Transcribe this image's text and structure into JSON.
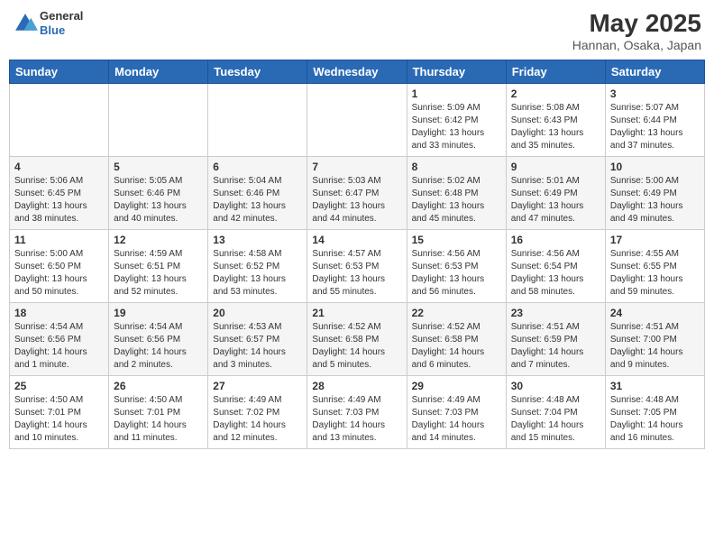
{
  "header": {
    "logo": {
      "line1": "General",
      "line2": "Blue"
    },
    "title": "May 2025",
    "subtitle": "Hannan, Osaka, Japan"
  },
  "weekdays": [
    "Sunday",
    "Monday",
    "Tuesday",
    "Wednesday",
    "Thursday",
    "Friday",
    "Saturday"
  ],
  "weeks": [
    [
      {
        "day": "",
        "info": ""
      },
      {
        "day": "",
        "info": ""
      },
      {
        "day": "",
        "info": ""
      },
      {
        "day": "",
        "info": ""
      },
      {
        "day": "1",
        "info": "Sunrise: 5:09 AM\nSunset: 6:42 PM\nDaylight: 13 hours\nand 33 minutes."
      },
      {
        "day": "2",
        "info": "Sunrise: 5:08 AM\nSunset: 6:43 PM\nDaylight: 13 hours\nand 35 minutes."
      },
      {
        "day": "3",
        "info": "Sunrise: 5:07 AM\nSunset: 6:44 PM\nDaylight: 13 hours\nand 37 minutes."
      }
    ],
    [
      {
        "day": "4",
        "info": "Sunrise: 5:06 AM\nSunset: 6:45 PM\nDaylight: 13 hours\nand 38 minutes."
      },
      {
        "day": "5",
        "info": "Sunrise: 5:05 AM\nSunset: 6:46 PM\nDaylight: 13 hours\nand 40 minutes."
      },
      {
        "day": "6",
        "info": "Sunrise: 5:04 AM\nSunset: 6:46 PM\nDaylight: 13 hours\nand 42 minutes."
      },
      {
        "day": "7",
        "info": "Sunrise: 5:03 AM\nSunset: 6:47 PM\nDaylight: 13 hours\nand 44 minutes."
      },
      {
        "day": "8",
        "info": "Sunrise: 5:02 AM\nSunset: 6:48 PM\nDaylight: 13 hours\nand 45 minutes."
      },
      {
        "day": "9",
        "info": "Sunrise: 5:01 AM\nSunset: 6:49 PM\nDaylight: 13 hours\nand 47 minutes."
      },
      {
        "day": "10",
        "info": "Sunrise: 5:00 AM\nSunset: 6:49 PM\nDaylight: 13 hours\nand 49 minutes."
      }
    ],
    [
      {
        "day": "11",
        "info": "Sunrise: 5:00 AM\nSunset: 6:50 PM\nDaylight: 13 hours\nand 50 minutes."
      },
      {
        "day": "12",
        "info": "Sunrise: 4:59 AM\nSunset: 6:51 PM\nDaylight: 13 hours\nand 52 minutes."
      },
      {
        "day": "13",
        "info": "Sunrise: 4:58 AM\nSunset: 6:52 PM\nDaylight: 13 hours\nand 53 minutes."
      },
      {
        "day": "14",
        "info": "Sunrise: 4:57 AM\nSunset: 6:53 PM\nDaylight: 13 hours\nand 55 minutes."
      },
      {
        "day": "15",
        "info": "Sunrise: 4:56 AM\nSunset: 6:53 PM\nDaylight: 13 hours\nand 56 minutes."
      },
      {
        "day": "16",
        "info": "Sunrise: 4:56 AM\nSunset: 6:54 PM\nDaylight: 13 hours\nand 58 minutes."
      },
      {
        "day": "17",
        "info": "Sunrise: 4:55 AM\nSunset: 6:55 PM\nDaylight: 13 hours\nand 59 minutes."
      }
    ],
    [
      {
        "day": "18",
        "info": "Sunrise: 4:54 AM\nSunset: 6:56 PM\nDaylight: 14 hours\nand 1 minute."
      },
      {
        "day": "19",
        "info": "Sunrise: 4:54 AM\nSunset: 6:56 PM\nDaylight: 14 hours\nand 2 minutes."
      },
      {
        "day": "20",
        "info": "Sunrise: 4:53 AM\nSunset: 6:57 PM\nDaylight: 14 hours\nand 3 minutes."
      },
      {
        "day": "21",
        "info": "Sunrise: 4:52 AM\nSunset: 6:58 PM\nDaylight: 14 hours\nand 5 minutes."
      },
      {
        "day": "22",
        "info": "Sunrise: 4:52 AM\nSunset: 6:58 PM\nDaylight: 14 hours\nand 6 minutes."
      },
      {
        "day": "23",
        "info": "Sunrise: 4:51 AM\nSunset: 6:59 PM\nDaylight: 14 hours\nand 7 minutes."
      },
      {
        "day": "24",
        "info": "Sunrise: 4:51 AM\nSunset: 7:00 PM\nDaylight: 14 hours\nand 9 minutes."
      }
    ],
    [
      {
        "day": "25",
        "info": "Sunrise: 4:50 AM\nSunset: 7:01 PM\nDaylight: 14 hours\nand 10 minutes."
      },
      {
        "day": "26",
        "info": "Sunrise: 4:50 AM\nSunset: 7:01 PM\nDaylight: 14 hours\nand 11 minutes."
      },
      {
        "day": "27",
        "info": "Sunrise: 4:49 AM\nSunset: 7:02 PM\nDaylight: 14 hours\nand 12 minutes."
      },
      {
        "day": "28",
        "info": "Sunrise: 4:49 AM\nSunset: 7:03 PM\nDaylight: 14 hours\nand 13 minutes."
      },
      {
        "day": "29",
        "info": "Sunrise: 4:49 AM\nSunset: 7:03 PM\nDaylight: 14 hours\nand 14 minutes."
      },
      {
        "day": "30",
        "info": "Sunrise: 4:48 AM\nSunset: 7:04 PM\nDaylight: 14 hours\nand 15 minutes."
      },
      {
        "day": "31",
        "info": "Sunrise: 4:48 AM\nSunset: 7:05 PM\nDaylight: 14 hours\nand 16 minutes."
      }
    ]
  ]
}
